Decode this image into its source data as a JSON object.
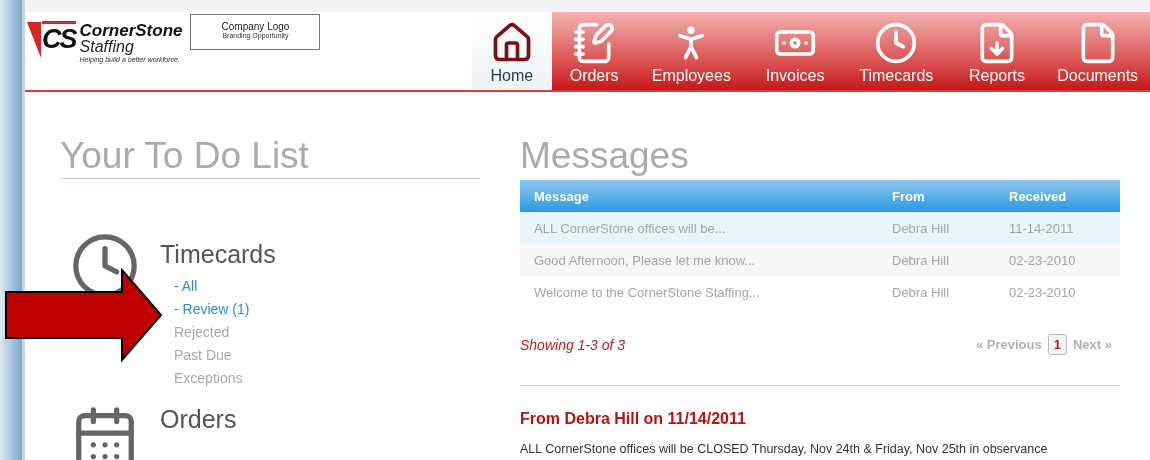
{
  "logo": {
    "mark": "CS",
    "name": "CornerStone",
    "sub": "Staffing",
    "tagline": "Helping build a better workforce."
  },
  "branding": {
    "title": "Company Logo",
    "subtitle": "Branding Opportunity"
  },
  "nav": [
    {
      "label": "Home",
      "selected": true
    },
    {
      "label": "Orders",
      "selected": false
    },
    {
      "label": "Employees",
      "selected": false
    },
    {
      "label": "Invoices",
      "selected": false
    },
    {
      "label": "Timecards",
      "selected": false
    },
    {
      "label": "Reports",
      "selected": false
    },
    {
      "label": "Documents",
      "selected": false
    }
  ],
  "todo": {
    "title": "Your To Do List",
    "sections": [
      {
        "title": "Timecards",
        "links": [
          {
            "label": "- All",
            "disabled": false
          },
          {
            "label": "- Review (1)",
            "disabled": false
          },
          {
            "label": "Rejected",
            "disabled": true
          },
          {
            "label": "Past Due",
            "disabled": true
          },
          {
            "label": "Exceptions",
            "disabled": true
          }
        ]
      },
      {
        "title": "Orders"
      }
    ]
  },
  "messages": {
    "title": "Messages",
    "columns": [
      "Message",
      "From",
      "Received"
    ],
    "rows": [
      {
        "cells": [
          "ALL CornerStone offices will be...",
          "Debra Hill",
          "11-14-2011"
        ],
        "selected": true
      },
      {
        "cells": [
          "Good Afternoon, Please let me know...",
          "Debra Hill",
          "02-23-2010"
        ],
        "selected": false
      },
      {
        "cells": [
          "Welcome to the CornerStone Staffing...",
          "Debra Hill",
          "02-23-2010"
        ],
        "selected": false
      }
    ],
    "showing": "Showing 1-3 of 3",
    "previous": "« Previous",
    "pages": [
      {
        "label": "1",
        "selected": true
      }
    ],
    "next": "Next »",
    "detail_title": "From Debra Hill on 11/14/2011",
    "detail_body": "ALL CornerStone offices will be CLOSED Thursday, Nov 24th & Friday, Nov 25th in observance"
  }
}
